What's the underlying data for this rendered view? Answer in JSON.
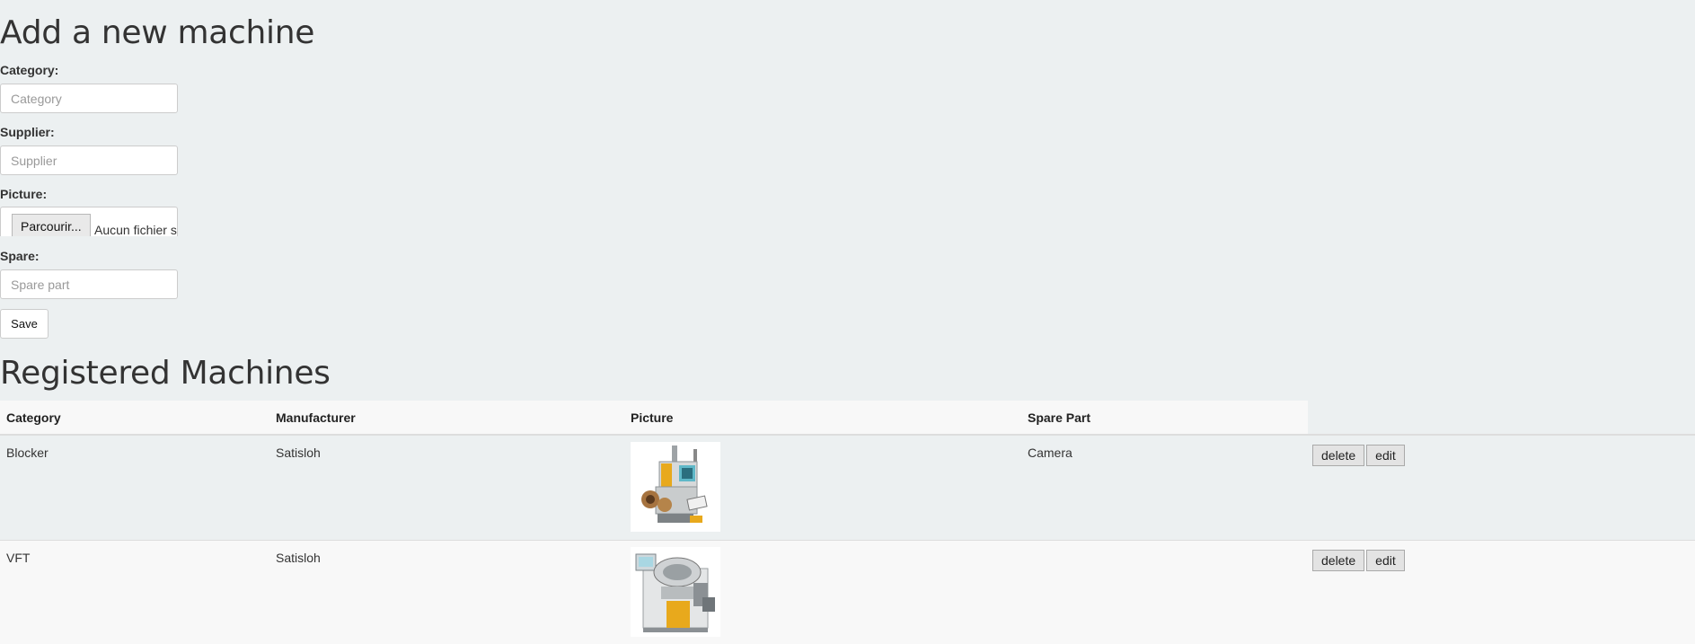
{
  "form": {
    "title": "Add a new machine",
    "category_label": "Category:",
    "category_placeholder": "Category",
    "supplier_label": "Supplier:",
    "supplier_placeholder": "Supplier",
    "picture_label": "Picture:",
    "file_button": "Parcourir...",
    "file_status": "Aucun fichier sélectionné.",
    "spare_label": "Spare:",
    "spare_placeholder": "Spare part",
    "save_label": "Save"
  },
  "registered": {
    "title": "Registered Machines",
    "columns": [
      "Category",
      "Manufacturer",
      "Picture",
      "Spare Part"
    ],
    "rows": [
      {
        "category": "Blocker",
        "manufacturer": "Satisloh",
        "picture": "blocker-machine-image",
        "spare_part": "Camera",
        "delete": "delete",
        "edit": "edit"
      },
      {
        "category": "VFT",
        "manufacturer": "Satisloh",
        "picture": "vft-machine-image",
        "spare_part": "",
        "delete": "delete",
        "edit": "edit"
      }
    ]
  },
  "colors": {
    "page_background": "#ecf0f1",
    "machine_accent": "#e8a91c"
  }
}
